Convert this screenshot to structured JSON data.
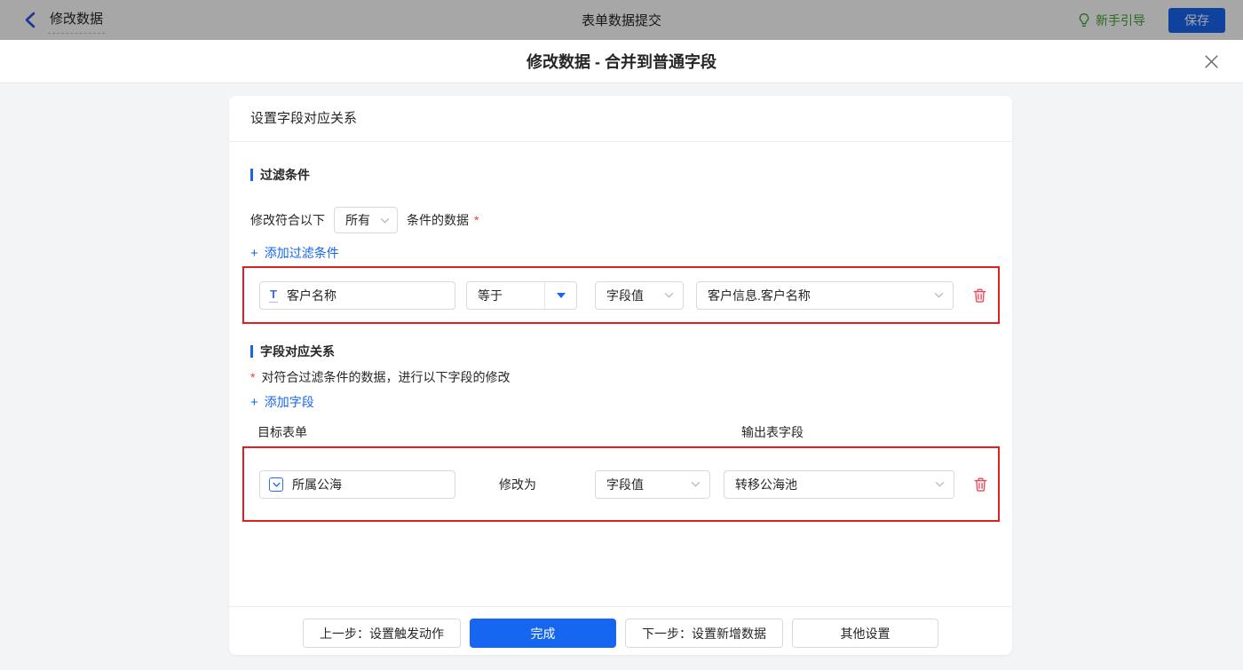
{
  "colors": {
    "accent": "#1766f0",
    "guide_green": "#3da338",
    "highlight_red": "#e02020",
    "danger_red": "#f0465a"
  },
  "topbar": {
    "back_label": "修改数据",
    "center_title": "表单数据提交",
    "guide_label": "新手引导",
    "save_label": "保存"
  },
  "dialog": {
    "title": "修改数据 - 合并到普通字段"
  },
  "panel": {
    "header_title": "设置字段对应关系",
    "filter": {
      "section_title": "过滤条件",
      "match_prefix": "修改符合以下",
      "match_value": "所有",
      "match_suffix": "条件的数据",
      "required_mark": "*",
      "add_plus": "+",
      "add_label": "添加过滤条件",
      "row": {
        "field_name": "客户名称",
        "field_type": "text",
        "field_type_icon_glyph": "T",
        "operator": "等于",
        "value_type": "字段值",
        "value_field": "客户信息.客户名称"
      }
    },
    "mapping": {
      "section_title": "字段对应关系",
      "required_mark": "*",
      "description": "对符合过滤条件的数据，进行以下字段的修改",
      "add_plus": "+",
      "add_label": "添加字段",
      "col_target": "目标表单",
      "col_output": "输出表字段",
      "row": {
        "field_name": "所属公海",
        "field_type": "select",
        "action_label": "修改为",
        "value_type": "字段值",
        "value_field": "转移公海池"
      }
    },
    "footer": {
      "prev_label": "上一步：设置触发动作",
      "done_label": "完成",
      "next_label": "下一步：设置新增数据",
      "other_label": "其他设置"
    }
  }
}
